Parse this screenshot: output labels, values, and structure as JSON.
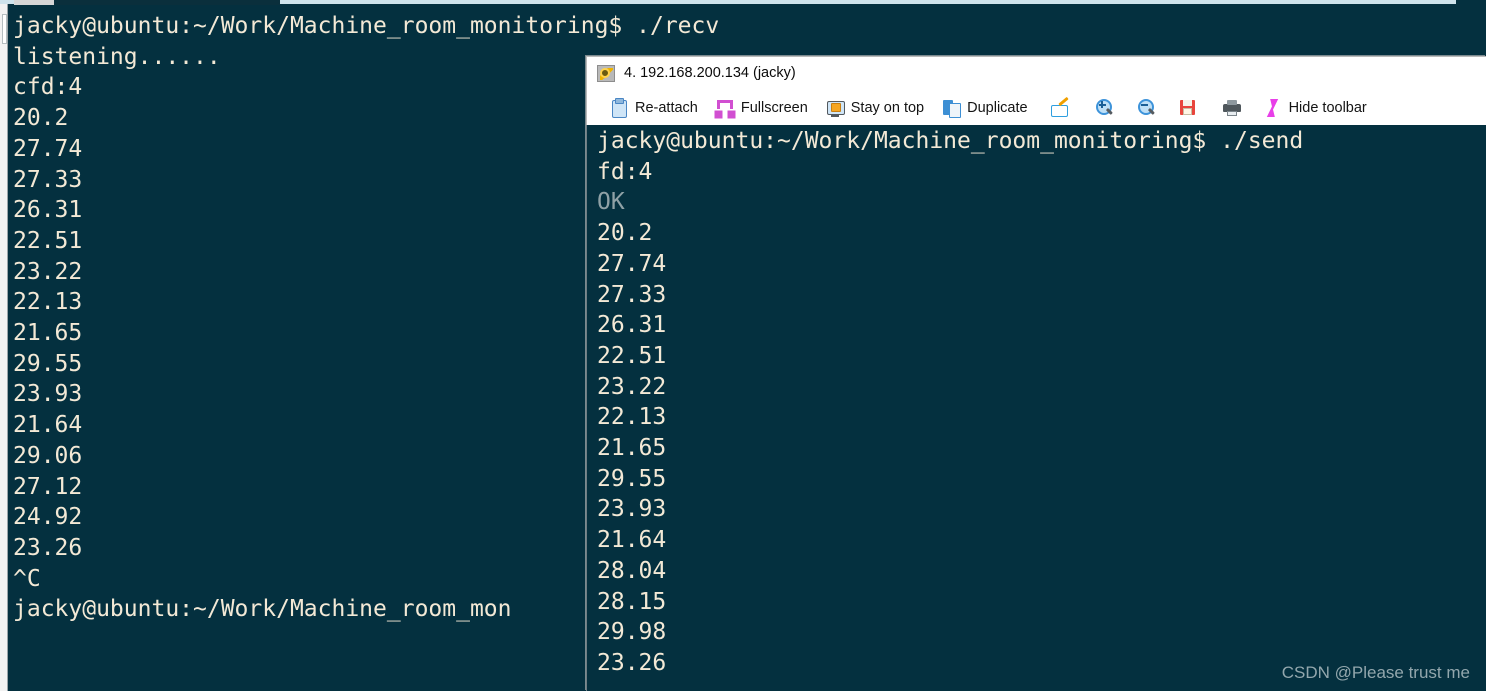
{
  "outer_window": {
    "tabs": [
      {
        "name": "tab-grey-inactive",
        "label": ""
      },
      {
        "name": "tab-dark-active",
        "label": ""
      }
    ],
    "terminal": {
      "prompt": "jacky@ubuntu:~/Work/Machine_room_monitoring$",
      "command": "./recv",
      "lines": [
        {
          "text": "jacky@ubuntu:~/Work/Machine_room_monitoring$ ./recv",
          "style": "normal"
        },
        {
          "text": "listening......",
          "style": "normal"
        },
        {
          "text": "cfd:4",
          "style": "normal"
        },
        {
          "text": "20.2",
          "style": "normal"
        },
        {
          "text": "27.74",
          "style": "normal"
        },
        {
          "text": "27.33",
          "style": "normal"
        },
        {
          "text": "26.31",
          "style": "normal"
        },
        {
          "text": "22.51",
          "style": "normal"
        },
        {
          "text": "23.22",
          "style": "normal"
        },
        {
          "text": "22.13",
          "style": "normal"
        },
        {
          "text": "21.65",
          "style": "normal"
        },
        {
          "text": "29.55",
          "style": "normal"
        },
        {
          "text": "23.93",
          "style": "normal"
        },
        {
          "text": "21.64",
          "style": "normal"
        },
        {
          "text": "29.06",
          "style": "normal"
        },
        {
          "text": "27.12",
          "style": "normal"
        },
        {
          "text": "24.92",
          "style": "normal"
        },
        {
          "text": "23.26",
          "style": "normal"
        },
        {
          "text": "^C",
          "style": "normal"
        },
        {
          "text": "jacky@ubuntu:~/Work/Machine_room_mon",
          "style": "normal"
        }
      ]
    }
  },
  "inner_window": {
    "title": "4. 192.168.200.134 (jacky)",
    "title_icon": "key-icon",
    "toolbar": {
      "items": [
        {
          "icon": "clipboard-icon",
          "label": "Re-attach"
        },
        {
          "icon": "fullscreen-icon",
          "label": "Fullscreen"
        },
        {
          "icon": "monitor-lock-icon",
          "label": "Stay on top"
        },
        {
          "icon": "duplicate-icon",
          "label": "Duplicate"
        },
        {
          "icon": "rename-icon",
          "label": ""
        },
        {
          "icon": "zoom-in-icon",
          "label": ""
        },
        {
          "icon": "zoom-out-icon",
          "label": ""
        },
        {
          "icon": "save-icon",
          "label": ""
        },
        {
          "icon": "print-icon",
          "label": ""
        },
        {
          "icon": "lightning-icon",
          "label": "Hide toolbar"
        }
      ]
    },
    "terminal": {
      "prompt": "jacky@ubuntu:~/Work/Machine_room_monitoring$",
      "command": "./send",
      "lines": [
        {
          "text": "jacky@ubuntu:~/Work/Machine_room_monitoring$ ./send",
          "style": "normal"
        },
        {
          "text": "fd:4",
          "style": "normal"
        },
        {
          "text": "OK",
          "style": "dim"
        },
        {
          "text": "20.2",
          "style": "normal"
        },
        {
          "text": "27.74",
          "style": "normal"
        },
        {
          "text": "27.33",
          "style": "normal"
        },
        {
          "text": "26.31",
          "style": "normal"
        },
        {
          "text": "22.51",
          "style": "normal"
        },
        {
          "text": "23.22",
          "style": "normal"
        },
        {
          "text": "22.13",
          "style": "normal"
        },
        {
          "text": "21.65",
          "style": "normal"
        },
        {
          "text": "29.55",
          "style": "normal"
        },
        {
          "text": "23.93",
          "style": "normal"
        },
        {
          "text": "21.64",
          "style": "normal"
        },
        {
          "text": "28.04",
          "style": "normal"
        },
        {
          "text": "28.15",
          "style": "normal"
        },
        {
          "text": "29.98",
          "style": "normal"
        },
        {
          "text": "23.26",
          "style": "normal"
        }
      ]
    }
  },
  "watermark": "CSDN @Please trust me",
  "colors": {
    "terminal_bg": "#04303f",
    "terminal_fg": "#f3e9d6",
    "terminal_dim": "#8fa1a6",
    "chrome_bg": "#ffffff",
    "tab_active": "#cfe3ec"
  }
}
